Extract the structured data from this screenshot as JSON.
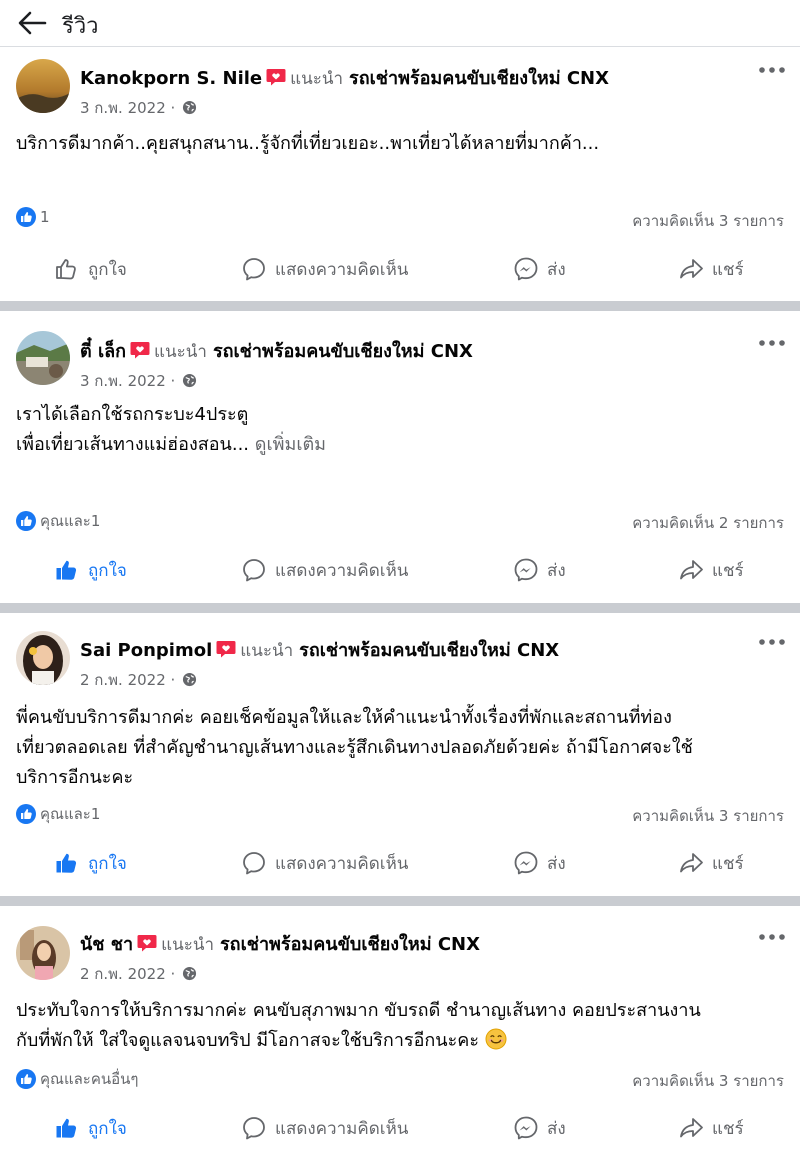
{
  "header": {
    "title": "รีวิว",
    "back_icon": "arrow-left-icon"
  },
  "colors": {
    "accent": "#1877f2",
    "secondary_text": "#65676b",
    "separator": "#c9ccd1",
    "recommend_badge": "#f02849"
  },
  "actions": {
    "like": "ถูกใจ",
    "comment": "แสดงความคิดเห็น",
    "send": "ส่ง",
    "share": "แชร์"
  },
  "posts": [
    {
      "author": "Kanokporn S. Nile",
      "recommend": "แนะนำ",
      "page": "รถเช่าพร้อมคนขับเชียงใหม่ CNX",
      "date": "3 ก.พ. 2022 ·",
      "text": "บริการดีมากค้า..คุยสนุกสนาน..รู้จักที่เที่ยวเยอะ..พาเที่ยวได้หลายที่มากค้า...",
      "reactions": "1",
      "comments": "ความคิดเห็น 3 รายการ",
      "liked": false
    },
    {
      "author": "ตี๋ เล็ก",
      "recommend": "แนะนำ",
      "page": "รถเช่าพร้อมคนขับเชียงใหม่ CNX",
      "date": "3 ก.พ. 2022 ·",
      "text_line1": "เราได้เลือกใช้รถกระบะ4ประตู",
      "text_line2": "เพื่อเที่ยวเส้นทางแม่ฮ่องสอน...",
      "see_more": "ดูเพิ่มเติม",
      "reactions": "คุณและ1",
      "comments": "ความคิดเห็น 2 รายการ",
      "liked": true
    },
    {
      "author": "Sai Ponpimol",
      "recommend": "แนะนำ",
      "page": "รถเช่าพร้อมคนขับเชียงใหม่ CNX",
      "date": "2 ก.พ. 2022 ·",
      "text_line1": "พี่คนขับบริการดีมากค่ะ คอยเช็คข้อมูลให้และให้คำแนะนำทั้งเรื่องที่พักและสถานที่ท่อง",
      "text_line2": "เที่ยวตลอดเลย ที่สำคัญชำนาญเส้นทางและรู้สึกเดินทางปลอดภัยด้วยค่ะ ถ้ามีโอกาศจะใช้",
      "text_line3": "บริการอีกนะคะ",
      "reactions": "คุณและ1",
      "comments": "ความคิดเห็น 3 รายการ",
      "liked": true
    },
    {
      "author": "นัช ชา",
      "recommend": "แนะนำ",
      "page": "รถเช่าพร้อมคนขับเชียงใหม่ CNX",
      "date": "2 ก.พ. 2022 ·",
      "text_line1": "ประทับใจการให้บริการมากค่ะ คนขับสุภาพมาก ขับรถดี ชำนาญเส้นทาง คอยประสานงาน",
      "text_line2": "กับที่พักให้ ใส่ใจดูแลจนจบทริป มีโอกาสจะใช้บริการอีกนะคะ",
      "emoji": "smiling-face-emoji",
      "reactions": "คุณและคนอื่นๆ",
      "comments": "ความคิดเห็น 3 รายการ",
      "liked": true
    }
  ]
}
